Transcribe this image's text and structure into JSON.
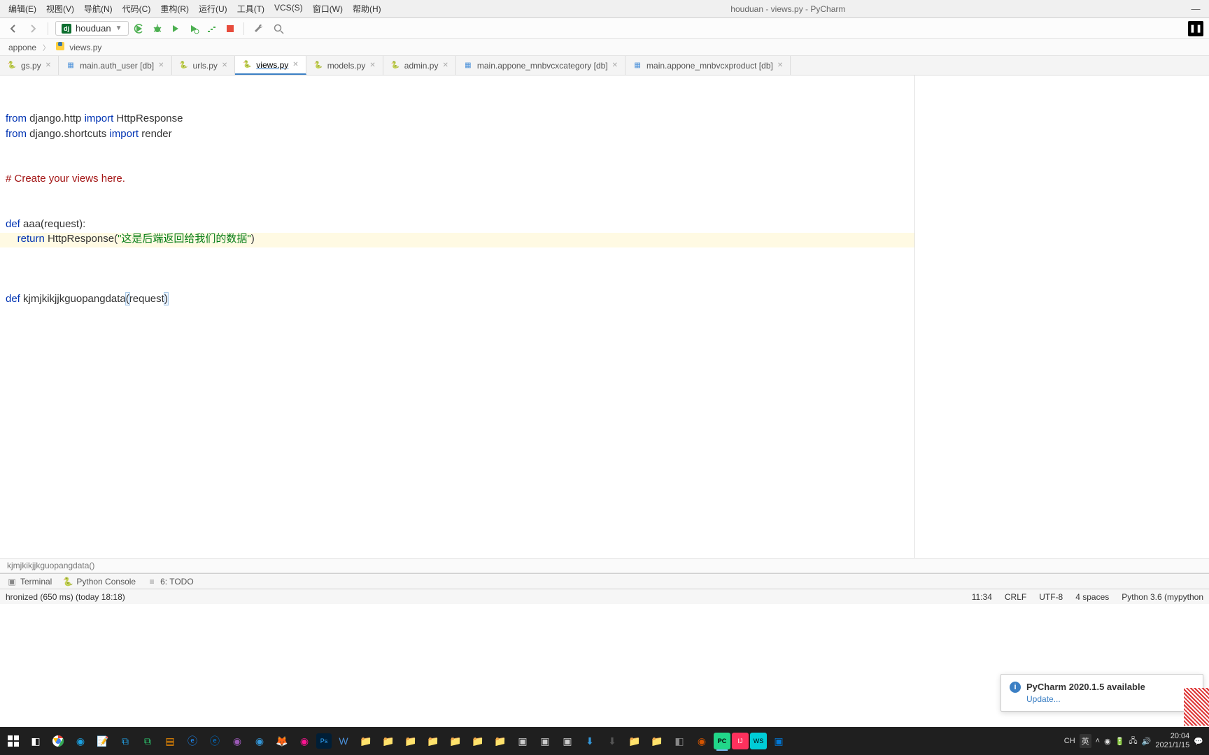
{
  "window": {
    "title": "houduan - views.py - PyCharm"
  },
  "menu": {
    "edit": "编辑(E)",
    "view": "视图(V)",
    "nav": "导航(N)",
    "code": "代码(C)",
    "refactor": "重构(R)",
    "run": "运行(U)",
    "tools": "工具(T)",
    "vcs": "VCS(S)",
    "window": "窗口(W)",
    "help": "帮助(H)"
  },
  "project_selector": "houduan",
  "breadcrumb": {
    "a": "appone",
    "b": "views.py"
  },
  "tabs": [
    {
      "label": "gs.py",
      "icon": "py",
      "closable": true
    },
    {
      "label": "main.auth_user [db]",
      "icon": "db",
      "closable": true
    },
    {
      "label": "urls.py",
      "icon": "py",
      "closable": true
    },
    {
      "label": "views.py",
      "icon": "py",
      "closable": true,
      "active": true
    },
    {
      "label": "models.py",
      "icon": "py",
      "closable": true
    },
    {
      "label": "admin.py",
      "icon": "py",
      "closable": true
    },
    {
      "label": "main.appone_mnbvcxcategory [db]",
      "icon": "db",
      "closable": true
    },
    {
      "label": "main.appone_mnbvcxproduct [db]",
      "icon": "db",
      "closable": true
    }
  ],
  "code": {
    "line1_a": "from",
    "line1_b": " django.http ",
    "line1_c": "import",
    "line1_d": " HttpResponse",
    "line2_a": "from",
    "line2_b": " django.shortcuts ",
    "line2_c": "import",
    "line2_d": " render",
    "line4": "# Create your views here.",
    "line7_a": "def ",
    "line7_b": "aaa(request):",
    "line8_a": "    return",
    "line8_b": " HttpResponse(",
    "line8_c": "\"这是后端返回给我们的数据\"",
    "line8_d": ")",
    "line12_a": "def ",
    "line12_b": "kjmjkikjjkguopangdata",
    "line12_c": "(",
    "line12_d": "request",
    "line12_e": ")"
  },
  "func_breadcrumb": "kjmjkikjjkguopangdata()",
  "tool_tabs": {
    "terminal": "Terminal",
    "console": "Python Console",
    "todo": "6: TODO"
  },
  "status": {
    "left": "hronized (650 ms) (today 18:18)",
    "pos": "11:34",
    "linesep": "CRLF",
    "encoding": "UTF-8",
    "indent": "4 spaces",
    "interp": "Python 3.6 (mypython"
  },
  "notification": {
    "title": "PyCharm 2020.1.5 available",
    "link": "Update..."
  },
  "tray": {
    "ime1": "CH",
    "ime2": "英",
    "time": "20:04",
    "date": "2021/1/15"
  }
}
